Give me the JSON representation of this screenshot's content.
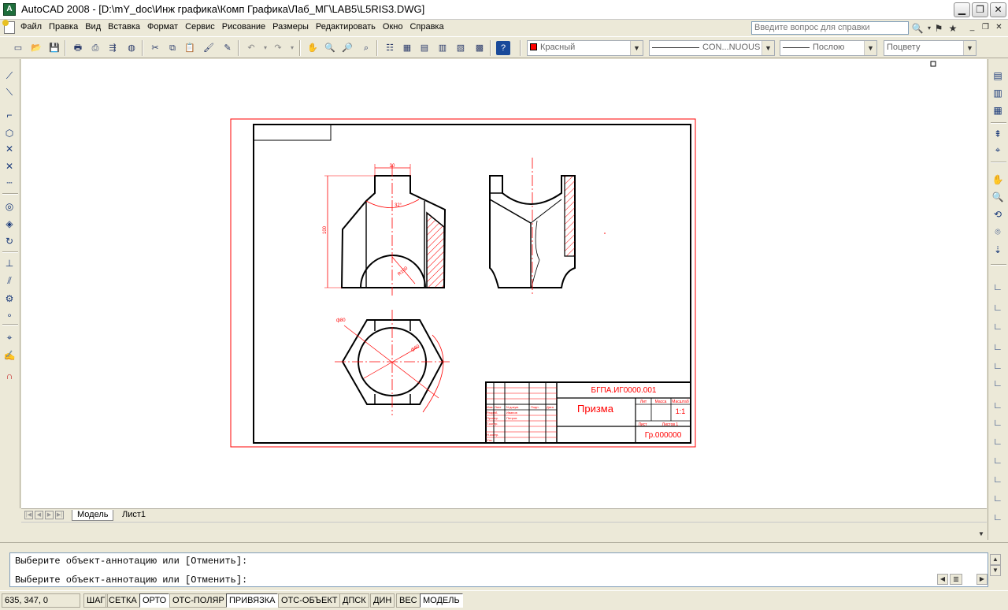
{
  "window": {
    "title": "AutoCAD 2008 - [D:\\mY_doc\\Инж графика\\Комп Графика\\Лаб_МГ\\LAB5\\L5RIS3.DWG]",
    "app_icon_text": "A",
    "controls": {
      "minimize": "▁",
      "restore": "❐",
      "close": "✕"
    }
  },
  "menu": {
    "items": [
      "Файл",
      "Правка",
      "Вид",
      "Вставка",
      "Формат",
      "Сервис",
      "Рисование",
      "Размеры",
      "Редактировать",
      "Окно",
      "Справка"
    ],
    "help_placeholder": "Введите вопрос для справки"
  },
  "toolbar": {
    "color_combo": "Красный",
    "linetype_combo": "CON...NUOUS",
    "lineweight_combo": "Послою",
    "plotstyle_combo": "Поцвету"
  },
  "drawing": {
    "title_block": {
      "doc_code": "БГПА.ИГ0000.001",
      "part_name": "Призма",
      "scale": "1:1",
      "group": "Гр.000000",
      "col_lit": "Лит",
      "col_mass": "Масса",
      "col_scale": "Масштаб",
      "col_sheet": "Лист",
      "col_sheets": "Листов 1",
      "col_izm": "Изм",
      "col_list": "Лист",
      "col_ndoc": "N докум.",
      "col_podp": "Подп.",
      "col_data": "Дата",
      "row_razrab": "Разраб.",
      "row_prover": "Провер.",
      "row_tkontr": "Т.контр.",
      "row_nkontr": "Н.контр.",
      "row_utv": "Утв.",
      "name_razrab": "Иванов",
      "name_prover": "Петров"
    },
    "dims": {
      "d30": "30",
      "d32": "32°",
      "d100": "100",
      "d_r100": "R100",
      "d_phi80": "ф80",
      "d_phi60": "ф60"
    }
  },
  "tabs": {
    "model": "Модель",
    "layout1": "Лист1"
  },
  "command": {
    "line1": "Выберите объект-аннотацию или [Отменить]:",
    "line2": "Выберите объект-аннотацию или [Отменить]:"
  },
  "status": {
    "coords": "635, 347, 0",
    "buttons": [
      "ШАГ",
      "СЕТКА",
      "ОРТО",
      "ОТС-ПОЛЯР",
      "ПРИВЯЗКА",
      "ОТС-ОБЪЕКТ",
      "ДПСК",
      "ДИН",
      "ВЕС",
      "МОДЕЛЬ"
    ],
    "active": [
      "ОРТО",
      "ПРИВЯЗКА",
      "МОДЕЛЬ"
    ]
  },
  "colors": {
    "accent_red": "#ff0000",
    "line_black": "#000000"
  }
}
